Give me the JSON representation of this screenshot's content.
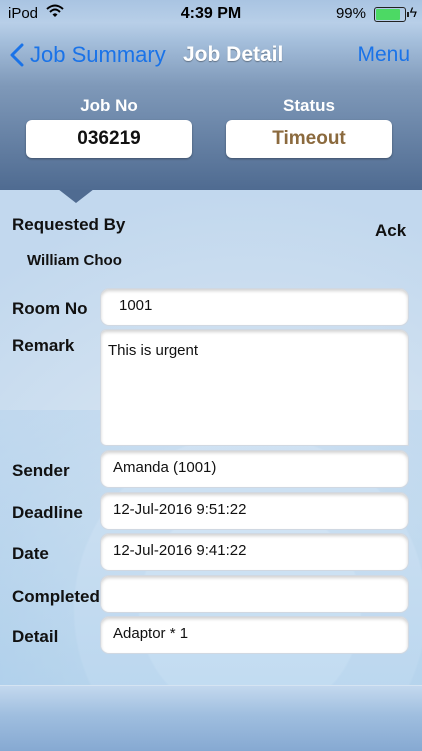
{
  "status_bar": {
    "carrier": "iPod",
    "time": "4:39 PM",
    "battery_pct": "99%"
  },
  "nav": {
    "back_label": "Job Summary",
    "title": "Job Detail",
    "menu_label": "Menu"
  },
  "header": {
    "job_no_label": "Job No",
    "job_no_value": "036219",
    "status_label": "Status",
    "status_value": "Timeout",
    "status_color": "#8b6a3e"
  },
  "requested_by": {
    "label": "Requested By",
    "name": "William Choo",
    "ack_label": "Ack"
  },
  "fields": {
    "room_no": {
      "label": "Room No",
      "value": "1001"
    },
    "remark": {
      "label": "Remark",
      "value": "This is urgent"
    },
    "sender": {
      "label": "Sender",
      "value": "Amanda (1001)"
    },
    "deadline": {
      "label": "Deadline",
      "value": "12-Jul-2016 9:51:22"
    },
    "date": {
      "label": "Date",
      "value": "12-Jul-2016 9:41:22"
    },
    "completed": {
      "label": "Completed",
      "value": ""
    },
    "detail": {
      "label": "Detail",
      "value": "Adaptor * 1"
    }
  },
  "colors": {
    "link_blue": "#1a73e8",
    "battery_green": "#4cd964"
  },
  "icons": [
    "wifi-icon",
    "battery-icon",
    "charging-bolt-icon",
    "chevron-left-icon"
  ]
}
